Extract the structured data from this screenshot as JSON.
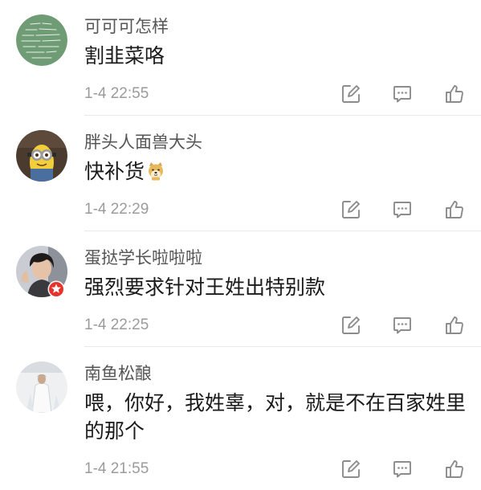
{
  "comments": [
    {
      "avatar": "green-handwriting-avatar",
      "username": "可可可怎样",
      "text": "割韭菜咯",
      "time": "1-4 22:55"
    },
    {
      "avatar": "minion-avatar",
      "username": "胖头人面兽大头",
      "text": "快补货",
      "emoji": "doge-emoji-icon",
      "time": "1-4 22:29"
    },
    {
      "avatar": "portrait-photo-avatar",
      "badge": "verified-badge-icon",
      "username": "蛋挞学长啦啦啦",
      "text": "强烈要求针对王姓出特别款",
      "time": "1-4 22:25"
    },
    {
      "avatar": "light-photo-avatar",
      "username": "南鱼松酿",
      "text": "喂，你好，我姓辜，对，就是不在百家姓里的那个",
      "time": "1-4 21:55"
    }
  ],
  "actions": {
    "repost_icon": "repost-icon",
    "comment_icon": "comment-icon",
    "like_icon": "like-icon"
  },
  "colors": {
    "username": "#555555",
    "text": "#1a1a1a",
    "time": "#9b9b9b",
    "icon": "#8c8c8c",
    "divider": "#e8e8e8",
    "badge": "#e6322c"
  }
}
